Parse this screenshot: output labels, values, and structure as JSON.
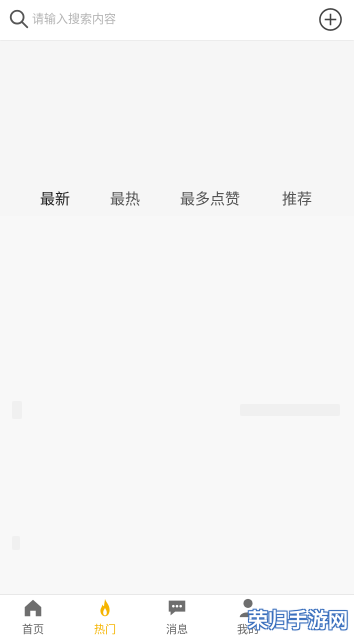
{
  "search": {
    "placeholder": "请输入搜索内容",
    "icon": "search-icon"
  },
  "header": {
    "add_icon": "plus-circle-icon"
  },
  "tabs": [
    {
      "label": "最新",
      "active": true
    },
    {
      "label": "最热",
      "active": false
    },
    {
      "label": "最多点赞",
      "active": false
    },
    {
      "label": "推荐",
      "active": false
    }
  ],
  "bottom_nav": [
    {
      "label": "首页",
      "icon": "home-icon",
      "active": false
    },
    {
      "label": "热门",
      "icon": "flame-icon",
      "active": true
    },
    {
      "label": "消息",
      "icon": "message-icon",
      "active": false
    },
    {
      "label": "我的",
      "icon": "user-icon",
      "active": false
    }
  ],
  "watermark": {
    "text": "荣归手游网"
  },
  "colors": {
    "accent": "#f5b400",
    "background": "#f6f6f6",
    "nav_icon": "#6e6e6e",
    "watermark_outline": "#3a6fbd"
  }
}
